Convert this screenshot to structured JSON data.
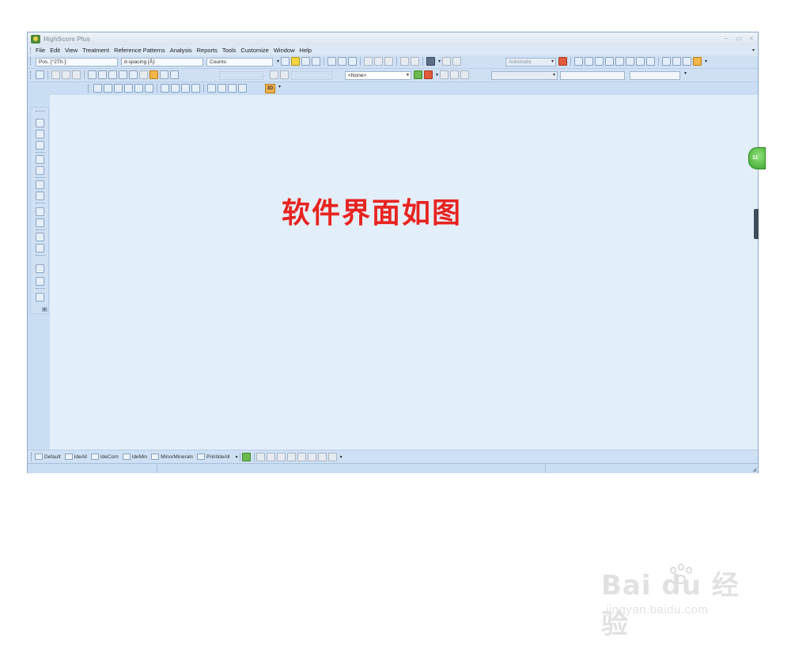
{
  "window": {
    "title": "HighScore Plus",
    "controls": [
      "–",
      "▭",
      "×"
    ]
  },
  "menubar": {
    "items": [
      "File",
      "Edit",
      "View",
      "Treatment",
      "Reference Patterns",
      "Analysis",
      "Reports",
      "Tools",
      "Customize",
      "Window",
      "Help"
    ],
    "overflow": "▾"
  },
  "toolbar1": {
    "pos_field": "Pos. [°2Th.]:",
    "dspacing_field": "d-spacing [Å]:",
    "counts_field": "Counts:",
    "scale_combo": "Automatic"
  },
  "toolbar2": {
    "none_combo": "<None>"
  },
  "toolbar3": {
    "badge_3d": "3D"
  },
  "document": {
    "overlay_caption": "软件界面如图"
  },
  "bottom_tabs": [
    "Default",
    "IdeAll",
    "IdeCom",
    "IdeMin",
    "MinorMinerals",
    "PrintIdeAll"
  ],
  "edge": {
    "orb_text": "11"
  },
  "watermark": {
    "logo": "Bai  du 经验",
    "url": "jingyan.baidu.com"
  },
  "colors": {
    "accent_orange": "#f2b64a",
    "caption_red": "#e8231f",
    "doc_background": "#e3eefb",
    "chrome_blue": "#cfe0f4"
  }
}
